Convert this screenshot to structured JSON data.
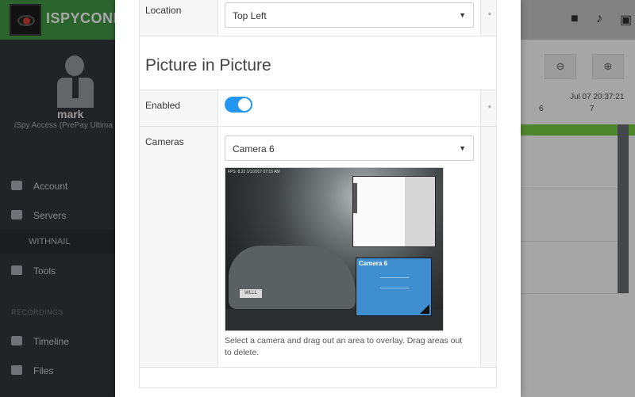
{
  "app": {
    "brand": "ISPYCONN"
  },
  "user": {
    "name": "mark",
    "subtitle": "iSpy Access (PrePay Ultima"
  },
  "sidebar": {
    "items": [
      {
        "label": "Account",
        "icon": "user-icon"
      },
      {
        "label": "Servers",
        "icon": "eye-icon"
      },
      {
        "label": "Tools",
        "icon": "briefcase-icon"
      },
      {
        "label": "Timeline",
        "icon": "list-icon"
      },
      {
        "label": "Files",
        "icon": "folder-icon"
      }
    ],
    "server_sub": "WITHNAIL",
    "section_recordings": "RECORDINGS"
  },
  "timeline": {
    "datetime": "Jul 07 20:37:21",
    "ticks": [
      "6",
      "7"
    ]
  },
  "modal": {
    "location": {
      "label": "Location",
      "value": "Top Left"
    },
    "pip_heading": "Picture in Picture",
    "enabled": {
      "label": "Enabled",
      "on": true
    },
    "cameras": {
      "label": "Cameras",
      "value": "Camera 6"
    },
    "required_mark": "*",
    "preview": {
      "hud_text": "FPS: 8.22 1/1/2017 07:15 AM",
      "plate_text": "WLLL",
      "inset_camera_label": "Camera 6"
    },
    "hint": "Select a camera and drag out an area to overlay. Drag areas out to delete."
  },
  "colors": {
    "accent": "#2196f3",
    "topbar": "#4caf50",
    "sidebar": "#2f3236",
    "pip_inset": "#3f8fd0"
  }
}
